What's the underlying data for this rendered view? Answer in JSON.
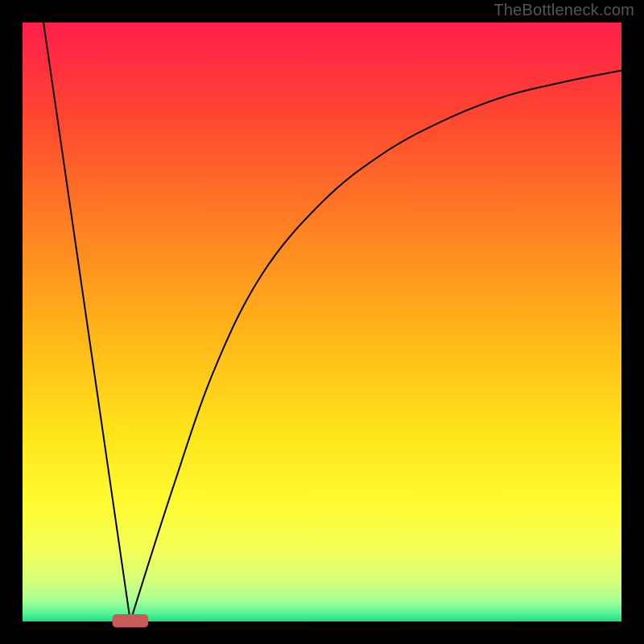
{
  "watermark": "TheBottleneck.com",
  "chart_data": {
    "type": "line",
    "title": "",
    "xlabel": "",
    "ylabel": "",
    "xlim": [
      0,
      100
    ],
    "ylim": [
      0,
      100
    ],
    "optimal_x": 18,
    "curve": {
      "left": [
        {
          "x": 3.5,
          "y": 100
        },
        {
          "x": 18,
          "y": 0
        }
      ],
      "right": [
        {
          "x": 18,
          "y": 0
        },
        {
          "x": 25,
          "y": 22
        },
        {
          "x": 32,
          "y": 42
        },
        {
          "x": 40,
          "y": 58
        },
        {
          "x": 50,
          "y": 70
        },
        {
          "x": 60,
          "y": 78
        },
        {
          "x": 70,
          "y": 83.5
        },
        {
          "x": 80,
          "y": 87.5
        },
        {
          "x": 90,
          "y": 90
        },
        {
          "x": 100,
          "y": 92
        }
      ]
    },
    "marker": {
      "x": 18,
      "width": 6,
      "height": 2
    },
    "gradient_stops": [
      {
        "offset": 0,
        "color": "#ff1e4c"
      },
      {
        "offset": 0.15,
        "color": "#ff4431"
      },
      {
        "offset": 0.32,
        "color": "#ff7a24"
      },
      {
        "offset": 0.5,
        "color": "#ffb01a"
      },
      {
        "offset": 0.68,
        "color": "#ffe319"
      },
      {
        "offset": 0.8,
        "color": "#fffb30"
      },
      {
        "offset": 0.88,
        "color": "#f4ff58"
      },
      {
        "offset": 0.93,
        "color": "#d6ff79"
      },
      {
        "offset": 0.965,
        "color": "#a8ff94"
      },
      {
        "offset": 0.985,
        "color": "#5cf59a"
      },
      {
        "offset": 1.0,
        "color": "#19e07e"
      }
    ],
    "border_color": "#000000",
    "curve_color": "#000000",
    "marker_color": "#c95a5a"
  }
}
